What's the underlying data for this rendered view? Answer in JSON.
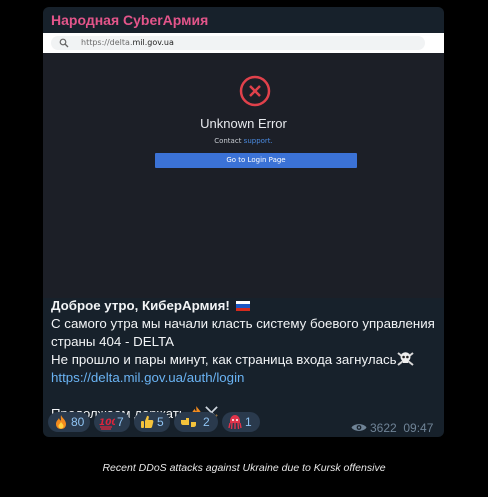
{
  "channel": {
    "name": "Народная CyberАрмия"
  },
  "screenshot": {
    "url_prefix": "https://delta.",
    "url_domain": "mil.gov.ua",
    "error_title": "Unknown Error",
    "contact_text": "Contact ",
    "contact_link": "support.",
    "login_button": "Go to Login Page"
  },
  "message": {
    "greeting": "Доброе утро, КиберАрмия!",
    "line1": "С самого утра мы начали класть систему боевого управления страны 404 - DELTA",
    "line2": "Не прошло и пары минут, как страница входа загнулась",
    "link": "https://delta.mil.gov.ua/auth/login",
    "line3": "Продолжаем держать"
  },
  "reactions": [
    {
      "icon": "fire-icon",
      "count": "80"
    },
    {
      "icon": "hundred-icon",
      "count": "7"
    },
    {
      "icon": "thumbs-up-icon",
      "count": "5"
    },
    {
      "icon": "fist-bump-icon",
      "count": "2"
    },
    {
      "icon": "squid-icon",
      "count": "1"
    }
  ],
  "meta": {
    "views": "3622",
    "time": "09:47"
  },
  "caption": "Recent DDoS attacks against Ukraine due to Kursk offensive",
  "colors": {
    "card_bg": "#17212b",
    "channel_name": "#e3558a",
    "link": "#6ab3f3",
    "button": "#3b72d6",
    "error_red": "#e0414b"
  }
}
